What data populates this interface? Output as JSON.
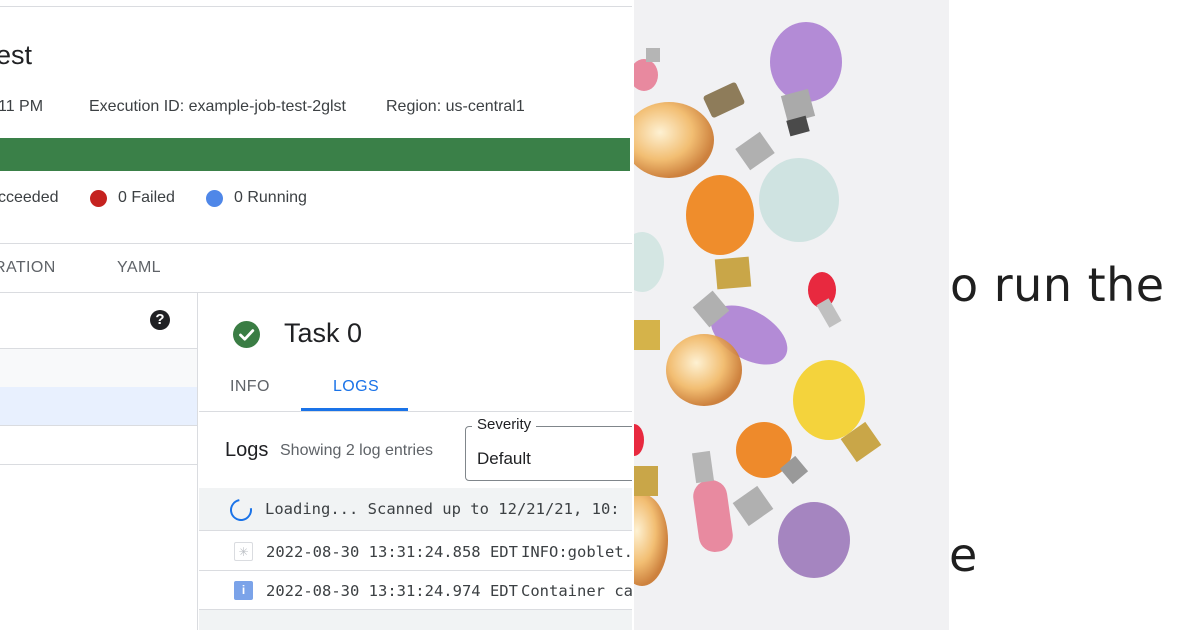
{
  "console": {
    "title": "est",
    "meta": {
      "time": "11 PM",
      "execution_id": "Execution ID: example-job-test-2glst",
      "region": "Region: us-central1"
    },
    "progress": {
      "succeeded_fraction": 1.0,
      "color": "#3a8048"
    },
    "status": {
      "succeeded": "cceeded",
      "failed": "0 Failed",
      "running": "0 Running",
      "failed_color": "#c5221f",
      "running_color": "#4f87e8"
    },
    "tabs": [
      "RATION",
      "YAML"
    ],
    "help_icon": "help-icon",
    "task": {
      "title": "Task 0",
      "status_icon": "check-circle-icon",
      "tabs": [
        "INFO",
        "LOGS"
      ],
      "active_tab": "LOGS"
    },
    "logs": {
      "title": "Logs",
      "count": "Showing 2 log entries",
      "severity_label": "Severity",
      "severity_value": "Default",
      "loading": "Loading... Scanned up to 12/21/21, 10:",
      "entries": [
        {
          "icon": "default-severity-icon",
          "timestamp": "2022-08-30 13:31:24.858 EDT",
          "message": "INFO:goblet.a"
        },
        {
          "icon": "info-severity-icon",
          "timestamp": "2022-08-30 13:31:24.974 EDT",
          "message": "Container ca"
        }
      ]
    },
    "accent": "#1a73e8"
  },
  "photo": {
    "subject": "colorful light bulbs"
  },
  "right": {
    "line1": "o run the",
    "line2": "e"
  }
}
